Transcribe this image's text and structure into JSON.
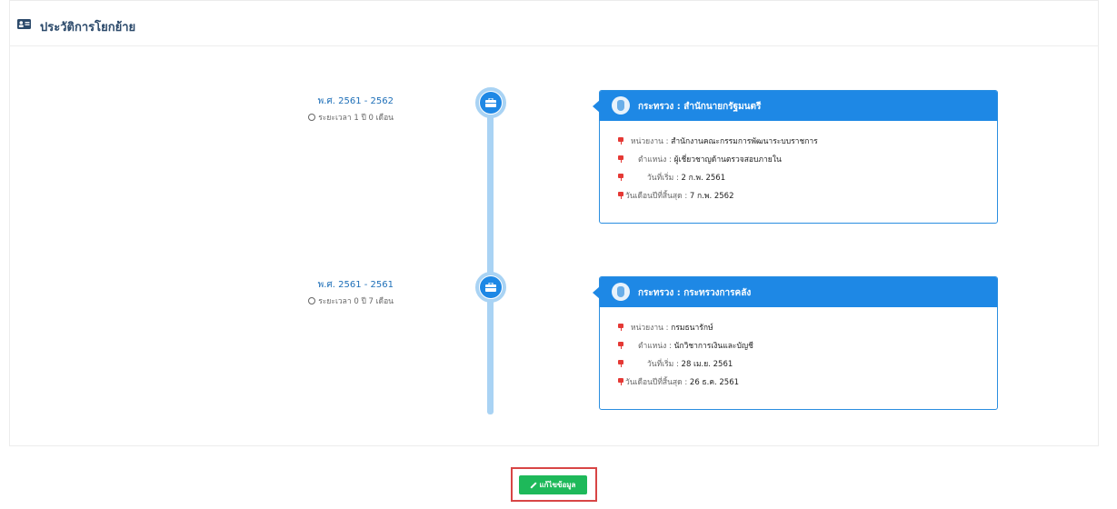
{
  "header": {
    "title": "ประวัติการโยกย้าย",
    "icon": "id-card-icon"
  },
  "timeline": [
    {
      "period": "พ.ศ. 2561 - 2562",
      "duration": "ระยะเวลา 1 ปี 0 เดือน",
      "title": "กระทรวง : สำนักนายกรัฐมนตรี",
      "rows": [
        {
          "label": "หน่วยงาน :",
          "value": "สำนักงานคณะกรรมการพัฒนาระบบราชการ"
        },
        {
          "label": "ตำแหน่ง :",
          "value": "ผู้เชี่ยวชาญด้านตรวจสอบภายใน"
        },
        {
          "label": "วันที่เริ่ม :",
          "value": "2 ก.พ. 2561"
        },
        {
          "label": "วันเดือนปีที่สิ้นสุด :",
          "value": "7 ก.พ. 2562"
        }
      ]
    },
    {
      "period": "พ.ศ. 2561 - 2561",
      "duration": "ระยะเวลา 0 ปี 7 เดือน",
      "title": "กระทรวง : กระทรวงการคลัง",
      "rows": [
        {
          "label": "หน่วยงาน :",
          "value": "กรมธนารักษ์"
        },
        {
          "label": "ตำแหน่ง :",
          "value": "นักวิชาการเงินและบัญชี"
        },
        {
          "label": "วันที่เริ่ม :",
          "value": "28 เม.ย. 2561"
        },
        {
          "label": "วันเดือนปีที่สิ้นสุด :",
          "value": "26 ธ.ค. 2561"
        }
      ]
    }
  ],
  "footer": {
    "edit_label": "แก้ไขข้อมูล"
  },
  "colors": {
    "accent": "#1e88e5",
    "timeline": "#a9d3f4",
    "button": "#1eb95a",
    "highlight": "#d84545",
    "pin": "#e53935"
  }
}
